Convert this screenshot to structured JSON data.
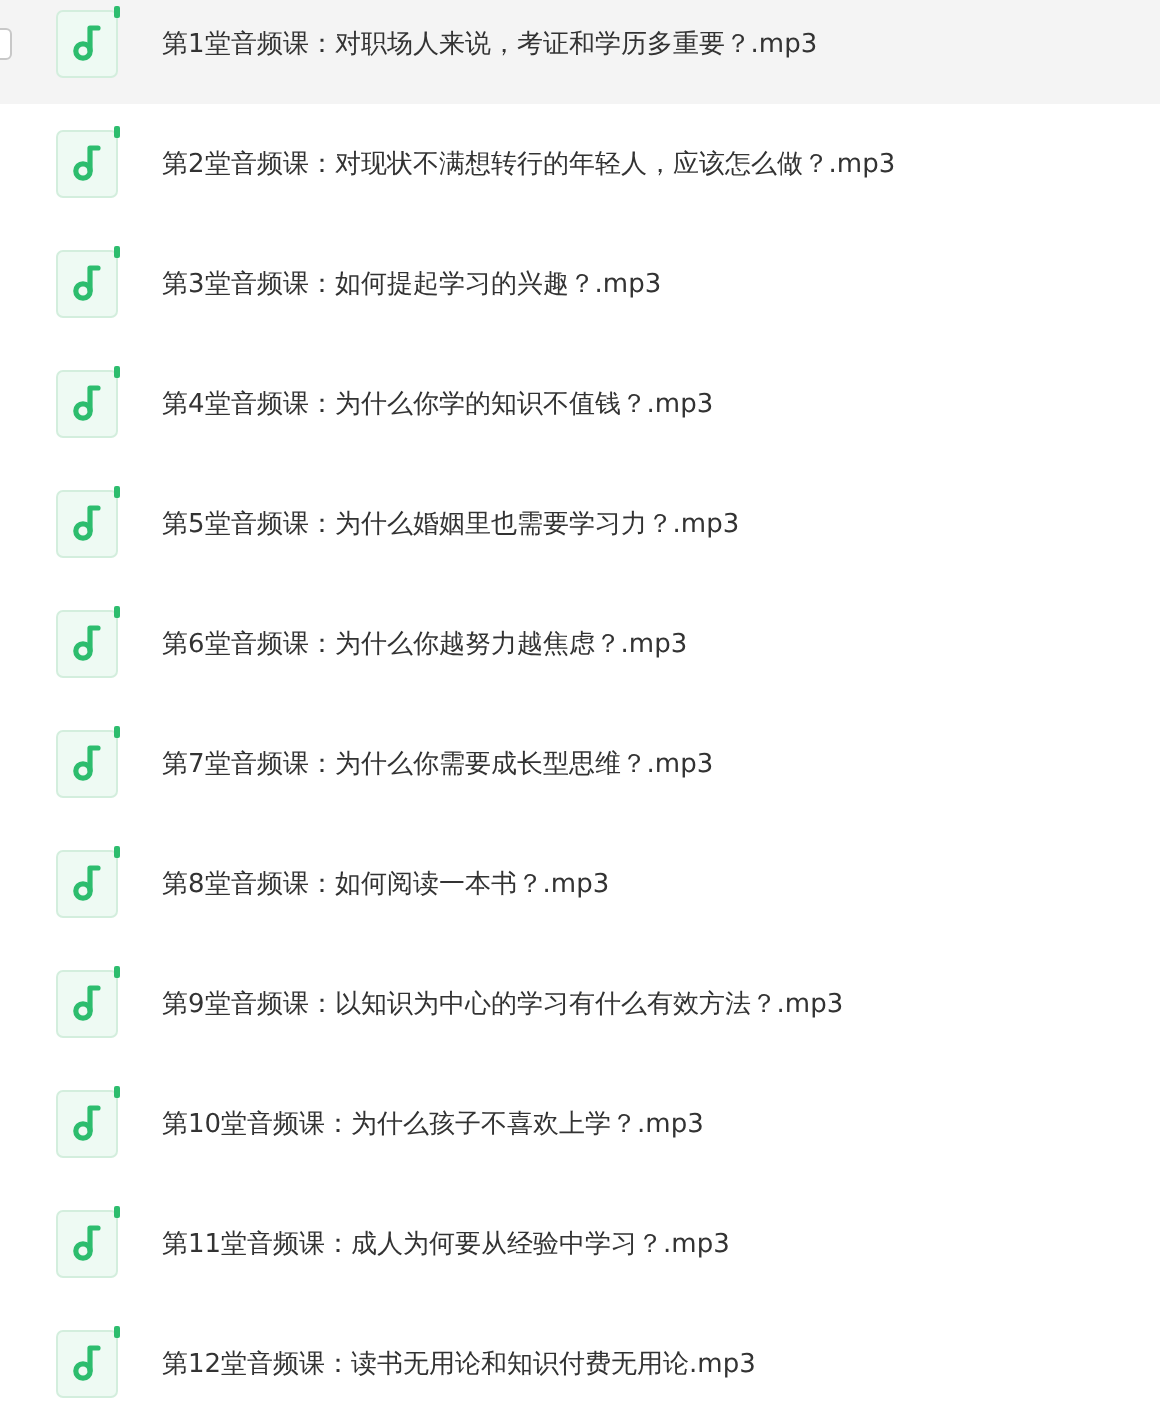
{
  "files": [
    {
      "name": "第1堂音频课：对职场人来说，考证和学历多重要？.mp3",
      "selected": true,
      "checked": false
    },
    {
      "name": "第2堂音频课：对现状不满想转行的年轻人，应该怎么做？.mp3",
      "selected": false,
      "checked": false
    },
    {
      "name": "第3堂音频课：如何提起学习的兴趣？.mp3",
      "selected": false,
      "checked": false
    },
    {
      "name": "第4堂音频课：为什么你学的知识不值钱？.mp3",
      "selected": false,
      "checked": false
    },
    {
      "name": "第5堂音频课：为什么婚姻里也需要学习力？.mp3",
      "selected": false,
      "checked": false
    },
    {
      "name": "第6堂音频课：为什么你越努力越焦虑？.mp3",
      "selected": false,
      "checked": false
    },
    {
      "name": "第7堂音频课：为什么你需要成长型思维？.mp3",
      "selected": false,
      "checked": false
    },
    {
      "name": "第8堂音频课：如何阅读一本书？.mp3",
      "selected": false,
      "checked": false
    },
    {
      "name": "第9堂音频课：以知识为中心的学习有什么有效方法？.mp3",
      "selected": false,
      "checked": false
    },
    {
      "name": "第10堂音频课：为什么孩子不喜欢上学？.mp3",
      "selected": false,
      "checked": false
    },
    {
      "name": "第11堂音频课：成人为何要从经验中学习？.mp3",
      "selected": false,
      "checked": false
    },
    {
      "name": "第12堂音频课：读书无用论和知识付费无用论.mp3",
      "selected": false,
      "checked": false
    }
  ]
}
